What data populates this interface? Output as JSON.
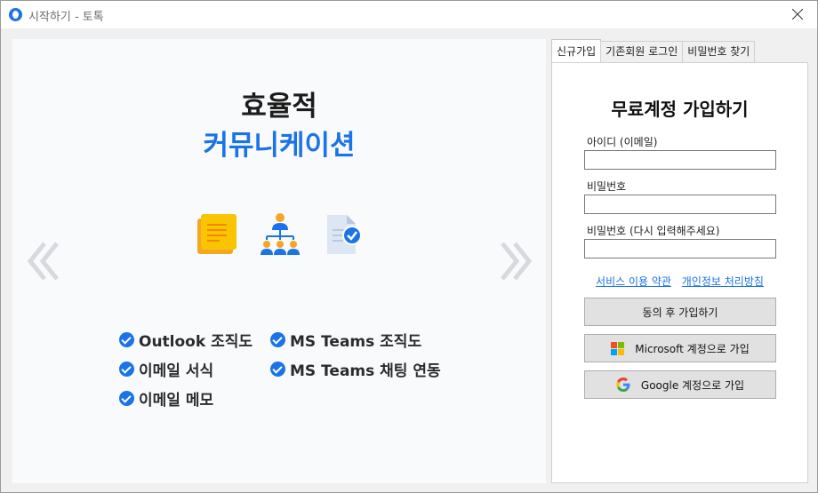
{
  "window": {
    "title": "시작하기 - 토톡"
  },
  "promo": {
    "headline_1": "효율적",
    "headline_2": "커뮤니케이션",
    "features": [
      "Outlook 조직도",
      "MS Teams 조직도",
      "이메일 서식",
      "MS Teams 채팅 연동",
      "이메일 메모"
    ],
    "nav_prev": "«",
    "nav_next": "»"
  },
  "tabs": [
    {
      "label": "신규가입",
      "active": true
    },
    {
      "label": "기존회원 로그인",
      "active": false
    },
    {
      "label": "비밀번호 찾기",
      "active": false
    }
  ],
  "form": {
    "title": "무료계정 가입하기",
    "id_label": "아이디 (이메일)",
    "id_value": "",
    "password_label": "비밀번호",
    "password_value": "",
    "password_confirm_label": "비밀번호 (다시 입력해주세요)",
    "password_confirm_value": "",
    "terms_link": "서비스 이용 약관",
    "privacy_link": "개인정보 처리방침",
    "signup_button": "동의 후 가입하기",
    "microsoft_button": "Microsoft 계정으로 가입",
    "google_button": "Google 계정으로 가입"
  },
  "colors": {
    "accent": "#1a73e8",
    "note_icon": "#f9b800",
    "org_icon_orange": "#f5a623",
    "org_icon_blue": "#1a73e8"
  },
  "icons": [
    "app-logo-icon",
    "close-icon",
    "sticky-note-icon",
    "org-chart-icon",
    "document-check-icon",
    "microsoft-logo-icon",
    "google-logo-icon"
  ]
}
